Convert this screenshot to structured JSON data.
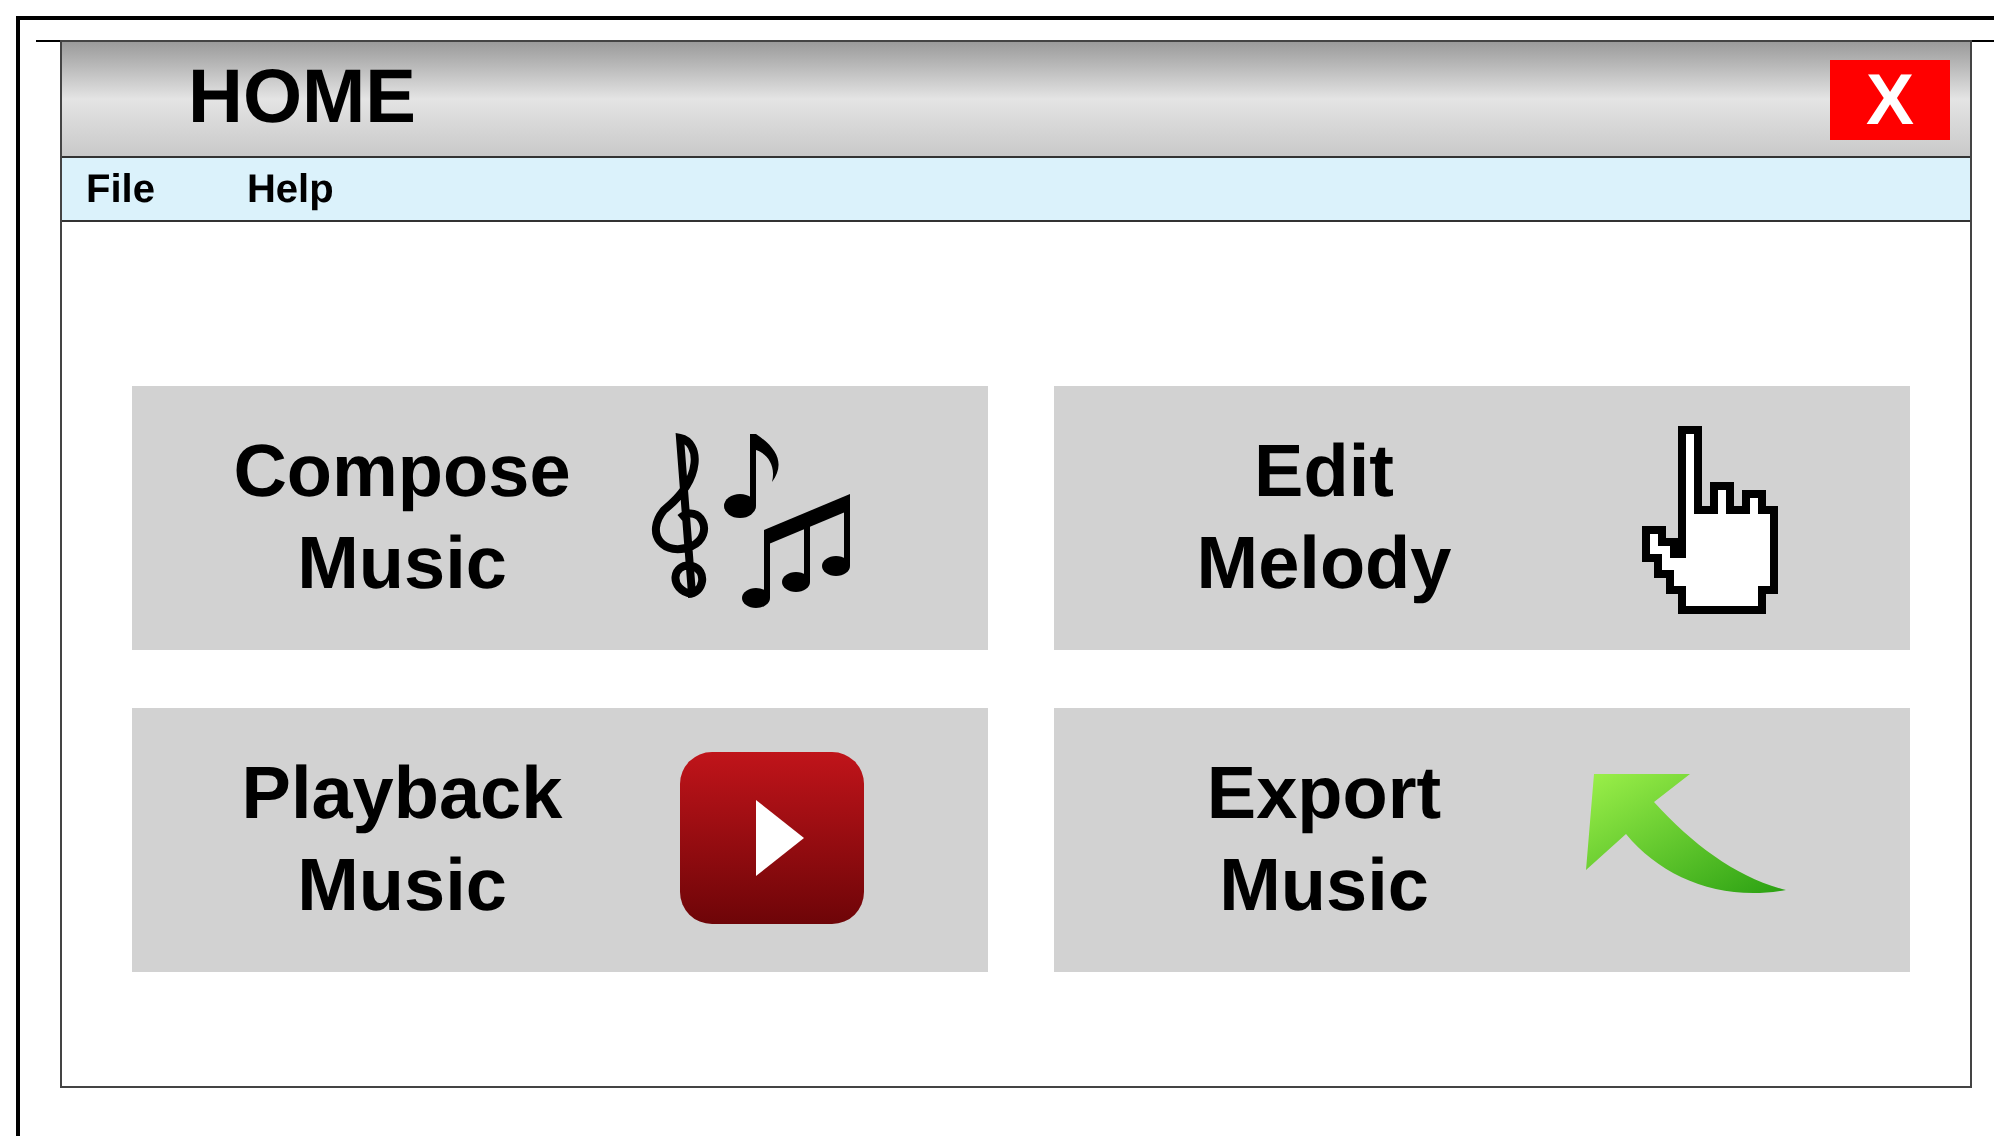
{
  "window": {
    "title": "HOME",
    "close_label": "X"
  },
  "menu": [
    "File",
    "Help"
  ],
  "tiles": [
    {
      "kind": "notes",
      "lines": [
        "Compose",
        "Music"
      ]
    },
    {
      "kind": "hand",
      "lines": [
        "Edit",
        "Melody"
      ]
    },
    {
      "kind": "play",
      "lines": [
        "Playback",
        "Music"
      ]
    },
    {
      "kind": "arrow",
      "lines": [
        "Export",
        "Music"
      ]
    }
  ]
}
